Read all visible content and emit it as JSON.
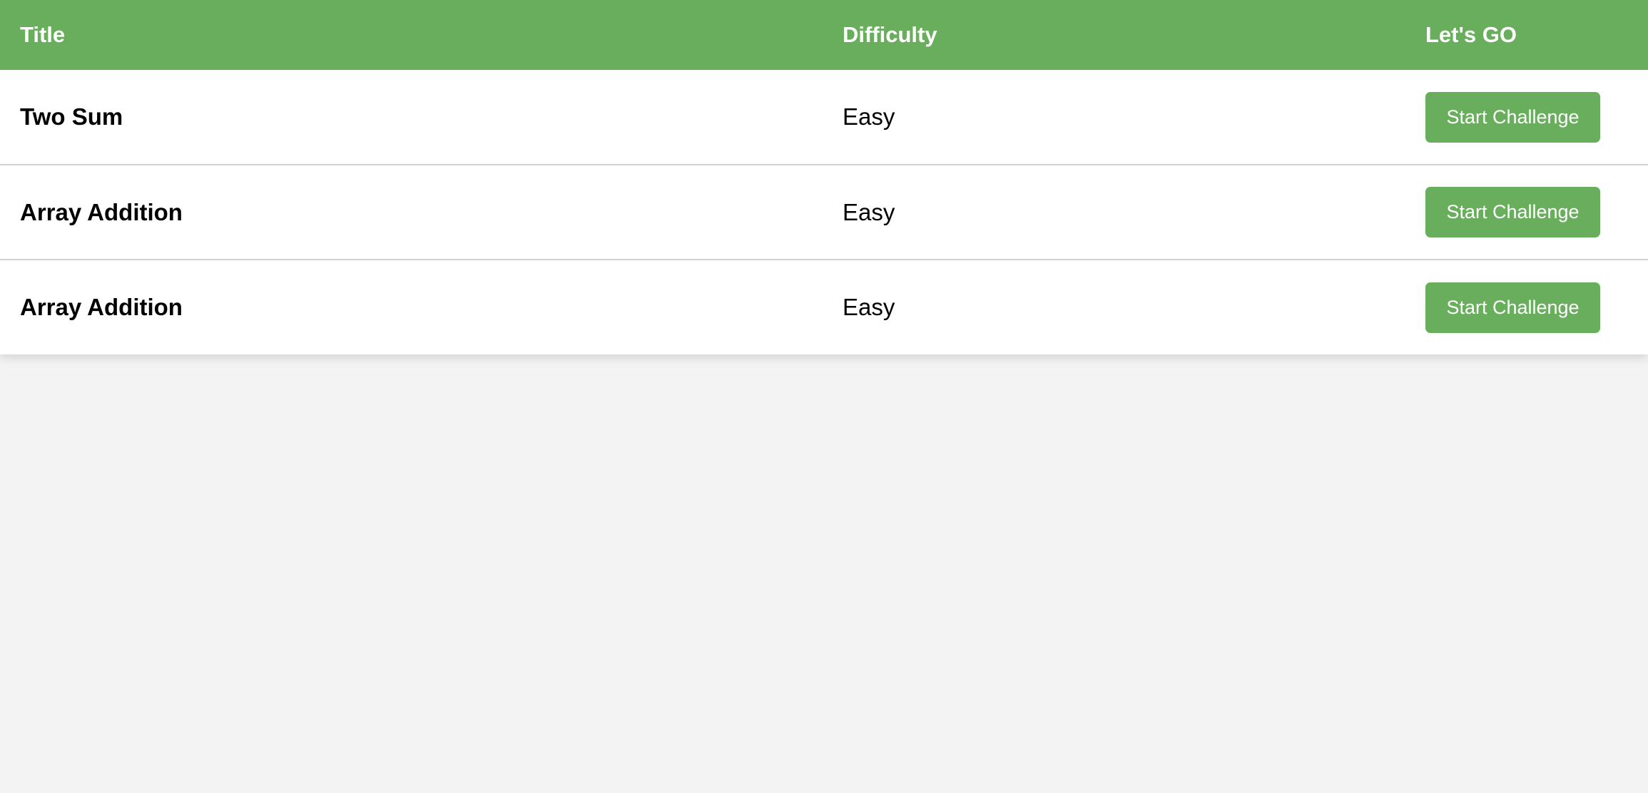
{
  "header": {
    "title": "Title",
    "difficulty": "Difficulty",
    "action": "Let's GO"
  },
  "rows": [
    {
      "title": "Two Sum",
      "difficulty": "Easy",
      "button": "Start Challenge"
    },
    {
      "title": "Array Addition",
      "difficulty": "Easy",
      "button": "Start Challenge"
    },
    {
      "title": "Array Addition",
      "difficulty": "Easy",
      "button": "Start Challenge"
    }
  ],
  "colors": {
    "accent": "#69ae5d",
    "page_background": "#f3f3f3",
    "row_divider": "#d2d2d2"
  }
}
